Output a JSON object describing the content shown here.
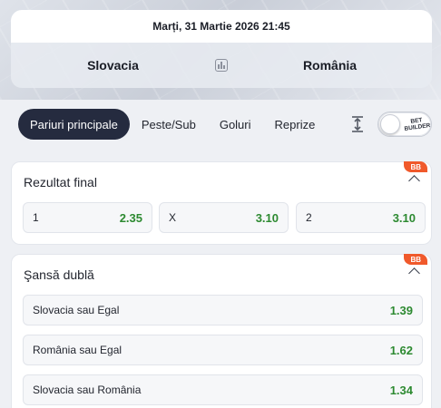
{
  "event": {
    "datetime": "Marți, 31 Martie 2026 21:45",
    "home": "Slovacia",
    "away": "România"
  },
  "tabs": [
    "Pariuri principale",
    "Peste/Sub",
    "Goluri",
    "Reprize"
  ],
  "toggle": {
    "label_line1": "BET",
    "label_line2": "BUILDER",
    "on": false
  },
  "markets": [
    {
      "title": "Rezultat final",
      "badge": "BB",
      "outcomes": [
        {
          "label": "1",
          "odd": "2.35"
        },
        {
          "label": "X",
          "odd": "3.10"
        },
        {
          "label": "2",
          "odd": "3.10"
        }
      ]
    },
    {
      "title": "Şansă dublă",
      "badge": "BB",
      "outcomes": [
        {
          "label": "Slovacia sau Egal",
          "odd": "1.39"
        },
        {
          "label": "România sau Egal",
          "odd": "1.62"
        },
        {
          "label": "Slovacia sau România",
          "odd": "1.34"
        }
      ]
    }
  ],
  "colors": {
    "accent_dark": "#252b3f",
    "odd_green": "#2d8a31",
    "badge_orange": "#f0592b"
  },
  "icons": [
    "stats-icon",
    "expand-vertical-icon",
    "chevron-up-icon"
  ]
}
